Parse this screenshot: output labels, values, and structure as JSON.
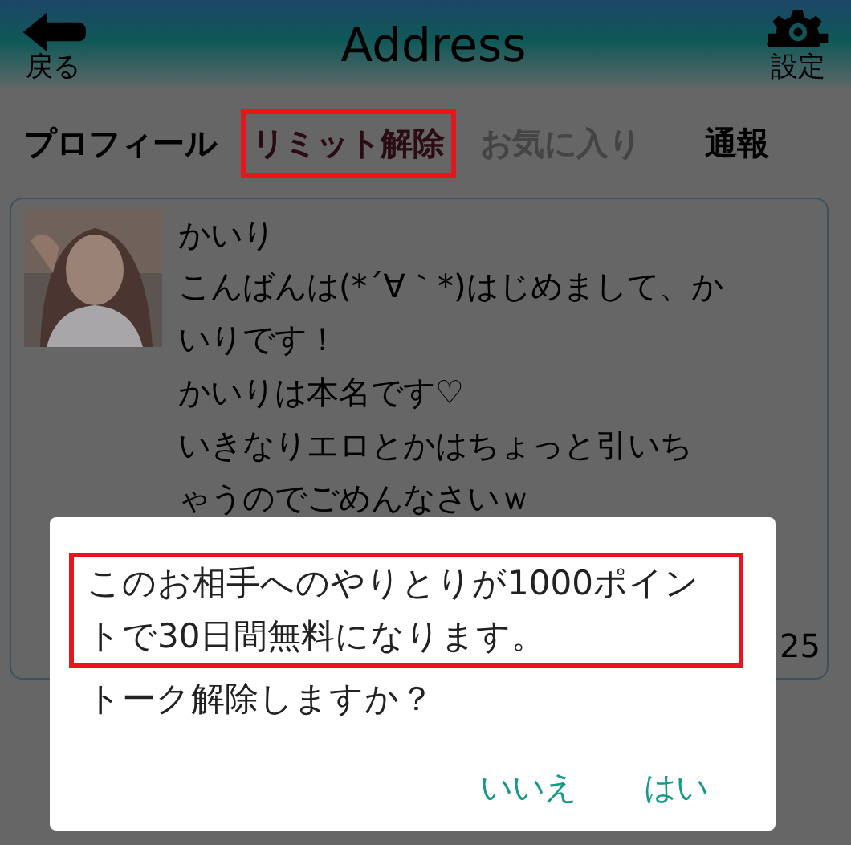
{
  "header": {
    "title": "Address",
    "back_label": "戻る",
    "settings_label": "設定"
  },
  "tabs": [
    {
      "label": "プロフィール",
      "selected": false,
      "disabled": false,
      "highlighted": false
    },
    {
      "label": "リミット解除",
      "selected": true,
      "disabled": false,
      "highlighted": true
    },
    {
      "label": "お気に入り",
      "selected": false,
      "disabled": true,
      "highlighted": false
    },
    {
      "label": "通報",
      "selected": false,
      "disabled": false,
      "highlighted": false
    }
  ],
  "profile": {
    "name": "かいり",
    "message_lines": [
      "こんばんは(*´∀｀*)はじめまして、か",
      "いりです！",
      "かいりは本名です♡",
      "いきなりエロとかはちょっと引いち",
      "ゃうのでごめんなさいｗ"
    ],
    "time_fragment": "25"
  },
  "dialog": {
    "message": [
      {
        "text": "このお相手へのやりとりが1000ポイントで30日間無料になります。",
        "highlighted": true
      },
      {
        "text": "トーク解除しますか？",
        "highlighted": false
      }
    ],
    "buttons": [
      "いいえ",
      "はい"
    ]
  }
}
